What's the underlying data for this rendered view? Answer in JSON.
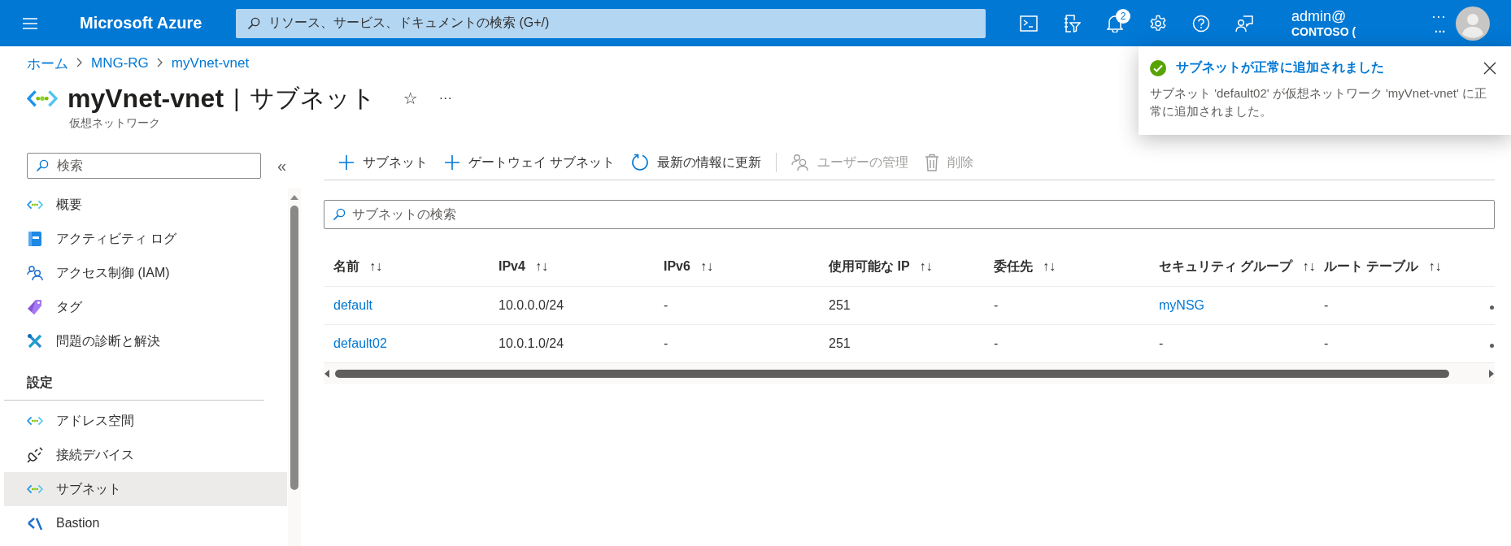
{
  "topbar": {
    "brand": "Microsoft Azure",
    "search": {
      "placeholder": "リソース、サービス、ドキュメントの検索 (G+/)"
    },
    "notification_count": "2",
    "account": {
      "user": "admin@",
      "user_more": "···",
      "directory": "CONTOSO (",
      "directory_more": "···"
    }
  },
  "breadcrumb": [
    "ホーム",
    "MNG-RG",
    "myVnet-vnet"
  ],
  "header": {
    "title": "myVnet-vnet",
    "separator": "|",
    "section": "サブネット",
    "favorite": "☆",
    "more": "···",
    "subtitle": "仮想ネットワーク"
  },
  "nav": {
    "search": {
      "placeholder": "検索"
    },
    "collapse": "«",
    "items": [
      {
        "kind": "item",
        "label": "概要",
        "selected": false
      },
      {
        "kind": "item",
        "label": "アクティビティ ログ",
        "selected": false
      },
      {
        "kind": "item",
        "label": "アクセス制御 (IAM)",
        "selected": false
      },
      {
        "kind": "item",
        "label": "タグ",
        "selected": false
      },
      {
        "kind": "item",
        "label": "問題の診断と解決",
        "selected": false
      },
      {
        "kind": "heading",
        "label": "設定"
      },
      {
        "kind": "item",
        "label": "アドレス空間",
        "selected": false
      },
      {
        "kind": "item",
        "label": "接続デバイス",
        "selected": false
      },
      {
        "kind": "item",
        "label": "サブネット",
        "selected": true
      },
      {
        "kind": "item",
        "label": "Bastion",
        "selected": false
      }
    ]
  },
  "toolbar": [
    {
      "label": "サブネット",
      "disabled": false
    },
    {
      "label": "ゲートウェイ サブネット",
      "disabled": false
    },
    {
      "label": "最新の情報に更新",
      "disabled": false
    },
    {
      "label": "ユーザーの管理",
      "disabled": true
    },
    {
      "label": "削除",
      "disabled": true
    }
  ],
  "table": {
    "search": {
      "placeholder": "サブネットの検索"
    },
    "columns": [
      {
        "label": "名前",
        "sort": "↑↓"
      },
      {
        "label": "IPv4",
        "sort": "↑↓"
      },
      {
        "label": "IPv6",
        "sort": "↑↓"
      },
      {
        "label": "使用可能な IP",
        "sort": "↑↓"
      },
      {
        "label": "委任先",
        "sort": "↑↓"
      },
      {
        "label": "セキュリティ グループ",
        "sort": "↑↓"
      },
      {
        "label": "ルート テーブル",
        "sort": "↑↓"
      }
    ],
    "rows": [
      {
        "cells": [
          {
            "text": "default",
            "kind": "link"
          },
          {
            "text": "10.0.0.0/24",
            "kind": "text"
          },
          {
            "text": "-",
            "kind": "text"
          },
          {
            "text": "251",
            "kind": "text"
          },
          {
            "text": "-",
            "kind": "text"
          },
          {
            "text": "myNSG",
            "kind": "link"
          },
          {
            "text": "-",
            "kind": "text"
          }
        ]
      },
      {
        "cells": [
          {
            "text": "default02",
            "kind": "link"
          },
          {
            "text": "10.0.1.0/24",
            "kind": "text"
          },
          {
            "text": "-",
            "kind": "text"
          },
          {
            "text": "251",
            "kind": "text"
          },
          {
            "text": "-",
            "kind": "text"
          },
          {
            "text": "-",
            "kind": "text"
          },
          {
            "text": "-",
            "kind": "text"
          }
        ]
      }
    ]
  },
  "notification": {
    "title": "サブネットが正常に追加されました",
    "message": "サブネット 'default02' が仮想ネットワーク 'myVnet-vnet' に正常に追加されました。"
  }
}
